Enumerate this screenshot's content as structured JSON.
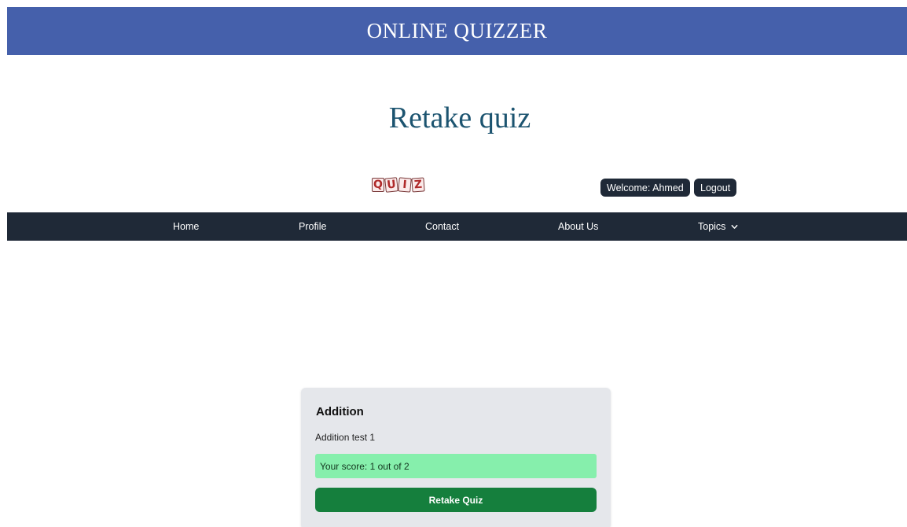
{
  "header": {
    "site_title": "ONLINE QUIZZER"
  },
  "page": {
    "heading": "Retake quiz"
  },
  "topbar": {
    "logo_letters": [
      "Q",
      "U",
      "I",
      "Z"
    ],
    "welcome_text": "Welcome: Ahmed",
    "logout_label": "Logout"
  },
  "nav": {
    "items": [
      {
        "label": "Home"
      },
      {
        "label": "Profile"
      },
      {
        "label": "Contact"
      },
      {
        "label": "About Us"
      },
      {
        "label": "Topics",
        "icon": "chevron-down-icon"
      }
    ]
  },
  "quiz_card": {
    "title": "Addition",
    "subtitle": "Addition test 1",
    "score_text": "Your score: 1 out of 2",
    "score": 1,
    "total": 2,
    "retake_label": "Retake Quiz"
  },
  "colors": {
    "banner": "#4560ab",
    "heading": "#1c5470",
    "navbar": "#1f2937",
    "card_bg": "#e5e7eb",
    "score_bg": "#86efac",
    "retake_button": "#157f3d"
  }
}
